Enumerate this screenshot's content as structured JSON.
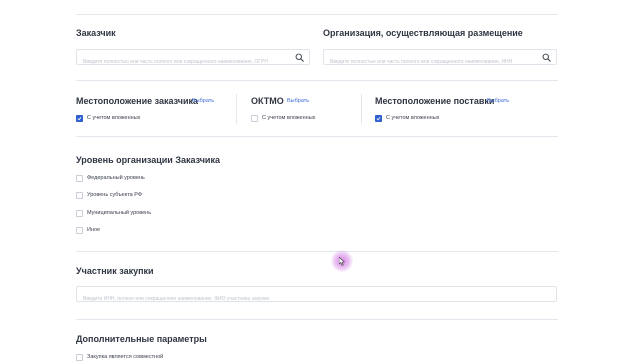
{
  "customer": {
    "title": "Заказчик",
    "placeholder": "Введите полностью или часть полного или сокращенного наименования, ОГРН"
  },
  "placing_org": {
    "title": "Организация, осуществляющая размещение",
    "placeholder": "Введите полностью или часть полного или сокращенного наименования, ИНН"
  },
  "location_customer": {
    "title": "Местоположение заказчика",
    "link": "Выбрать",
    "checkbox_label": "С учетом вложенных",
    "checked": true
  },
  "oktmo": {
    "title": "ОКТМО",
    "link": "Выбрать",
    "checkbox_label": "С учетом вложенных",
    "checked": false
  },
  "location_delivery": {
    "title": "Местоположение поставки",
    "link": "Выбрать",
    "checkbox_label": "С учетом вложенных",
    "checked": true
  },
  "customer_level": {
    "title": "Уровень организации Заказчика",
    "options": [
      {
        "label": "Федеральный уровень",
        "checked": false
      },
      {
        "label": "Уровень субъекта РФ",
        "checked": false
      },
      {
        "label": "Муниципальный уровень",
        "checked": false
      },
      {
        "label": "Иное",
        "checked": false
      }
    ]
  },
  "participant": {
    "title": "Участник закупки",
    "placeholder": "Введите ИНН, полное или сокращенное наименование, ФИО участника закупки"
  },
  "extra": {
    "title": "Дополнительные параметры",
    "options": [
      {
        "label": "Закупка является совместной",
        "checked": false
      }
    ]
  },
  "colors": {
    "accent": "#2f5fd0",
    "link": "#3f6fd8",
    "border": "#dfe3ea",
    "heading": "#2f3542"
  },
  "icons": [
    "search-icon",
    "checkmark-icon"
  ]
}
